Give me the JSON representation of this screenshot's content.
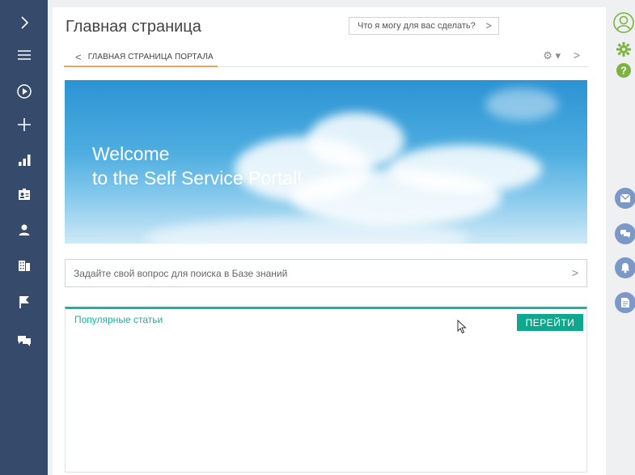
{
  "header": {
    "title": "Главная страница",
    "ask_label": "Что я могу для вас сделать?",
    "ask_chevron": ">"
  },
  "tab": {
    "back": "<",
    "label": "ГЛАВНАЯ СТРАНИЦА ПОРТАЛА",
    "gear": "⚙ ▾",
    "next": ">"
  },
  "banner": {
    "line1": "Welcome",
    "line2": "to the Self Service Portal!"
  },
  "search": {
    "placeholder": "Задайте свой вопрос для поиска в Базе знаний",
    "chevron": ">"
  },
  "articles": {
    "title": "Популярные статьи",
    "button": "ПЕРЕЙТИ"
  },
  "sidebar": {
    "items": [
      {
        "icon": "chevron-right-icon"
      },
      {
        "icon": "menu-icon"
      },
      {
        "icon": "play-icon"
      },
      {
        "icon": "plus-icon"
      },
      {
        "icon": "dashboard-icon"
      },
      {
        "icon": "id-card-icon"
      },
      {
        "icon": "person-icon"
      },
      {
        "icon": "building-icon"
      },
      {
        "icon": "flag-icon"
      },
      {
        "icon": "chat-icon"
      }
    ]
  },
  "right_rail": {
    "icons": [
      "profile-icon",
      "gear-icon",
      "help-icon",
      "email-icon",
      "chat-icon",
      "bell-icon",
      "document-icon"
    ]
  },
  "colors": {
    "sidebar": "#364a6b",
    "accent_orange": "#f0a35a",
    "teal": "#12b6a1",
    "button_teal": "#0fa88f",
    "rail_blue": "#7c98c7",
    "rail_green": "#7cb340"
  }
}
